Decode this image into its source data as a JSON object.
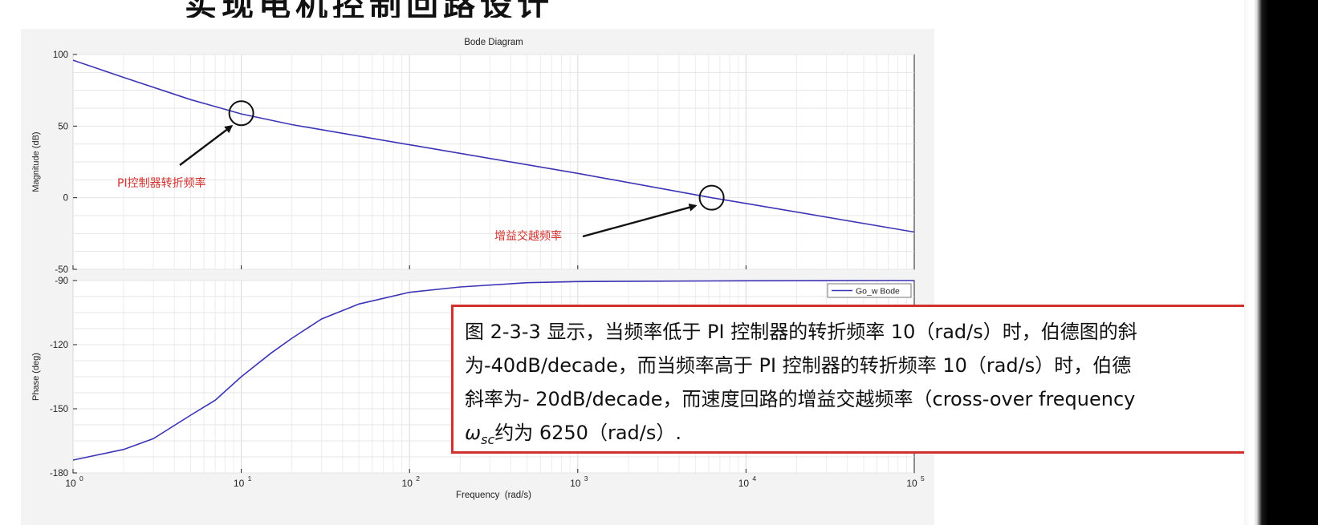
{
  "page": {
    "slide_title": "实现电机控制回路设计"
  },
  "chart_data": {
    "type": "line",
    "title": "Bode Diagram",
    "xlabel": "Frequency  (rad/s)",
    "x_scale": "log",
    "xlim": [
      1,
      100000
    ],
    "x_ticks": [
      {
        "base": "10",
        "exp": "0",
        "value": 1
      },
      {
        "base": "10",
        "exp": "1",
        "value": 10
      },
      {
        "base": "10",
        "exp": "2",
        "value": 100
      },
      {
        "base": "10",
        "exp": "3",
        "value": 1000
      },
      {
        "base": "10",
        "exp": "4",
        "value": 10000
      },
      {
        "base": "10",
        "exp": "5",
        "value": 100000
      }
    ],
    "grid": true,
    "legend": {
      "entries": [
        "Go_w Bode"
      ],
      "placement": "top-right of phase plot"
    },
    "colors": {
      "series": "#3b35b5"
    },
    "subplots": [
      {
        "name": "magnitude",
        "ylabel": "Magnitude (dB)",
        "ylim": [
          -50,
          100
        ],
        "y_ticks": [
          "100",
          "50",
          "0",
          "-50"
        ],
        "y_tick_values": [
          100,
          50,
          0,
          -50
        ],
        "series": [
          {
            "name": "Go_w Bode",
            "x": [
              1,
              2,
              5,
              10,
              20,
              50,
              100,
              1000,
              6250,
              10000,
              100000
            ],
            "y": [
              96,
              84,
              68.5,
              58.5,
              51,
              43,
              37,
              17,
              0,
              -4,
              -24
            ]
          }
        ],
        "annotations": [
          {
            "text": "PI控制器转折频率",
            "x": 10,
            "y": 59
          },
          {
            "text": "增益交越频率",
            "x": 6250,
            "y": 0
          }
        ]
      },
      {
        "name": "phase",
        "ylabel": "Phase (deg)",
        "ylim": [
          -180,
          -90
        ],
        "y_ticks": [
          "-90",
          "-120",
          "-150",
          "-180"
        ],
        "y_tick_values": [
          -90,
          -120,
          -150,
          -180
        ],
        "series": [
          {
            "name": "Go_w Bode",
            "x": [
              1,
              2,
              3,
              5,
              7,
              10,
              15,
              20,
              30,
              50,
              100,
              200,
              500,
              1000,
              10000,
              100000
            ],
            "y": [
              -174,
              -169,
              -164,
              -153,
              -146,
              -135,
              -124,
              -117,
              -108,
              -101,
              -95.5,
              -93,
              -91,
              -90.5,
              -90.1,
              -90
            ]
          }
        ]
      }
    ]
  },
  "note": {
    "lines": [
      "图 2-3-3 显示，当频率低于 PI 控制器的转折频率 10（rad/s）时，伯德图的斜",
      "为-40dB/decade，而当频率高于 PI 控制器的转折频率 10（rad/s）时，伯德",
      "斜率为- 20dB/decade，而速度回路的增益交越频率（cross-over frequency",
      "约为 6250（rad/s）."
    ],
    "omega_symbol": "ω",
    "omega_sub": "sc"
  }
}
